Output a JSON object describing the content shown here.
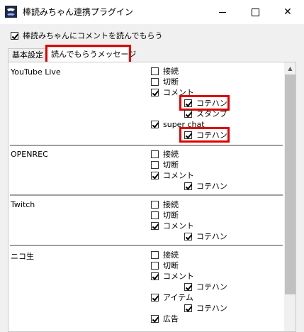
{
  "window": {
    "title": "棒読みちゃん連携プラグイン",
    "icon": "app-icon"
  },
  "main_option": {
    "label": "棒読みちゃんにコメントを読んでもらう",
    "checked": true
  },
  "tabs": [
    {
      "label": "基本設定",
      "active": false
    },
    {
      "label": "読んでもらうメッセージ",
      "active": true
    }
  ],
  "sections": {
    "youtube": {
      "title": "YouTube Live",
      "connect": {
        "label": "接続",
        "checked": false
      },
      "disconnect": {
        "label": "切断",
        "checked": false
      },
      "comment": {
        "label": "コメント",
        "checked": true
      },
      "comment_kotehan": {
        "label": "コテハン",
        "checked": true
      },
      "stamp": {
        "label": "スタンプ",
        "checked": true
      },
      "superchat": {
        "label": "super chat",
        "checked": true
      },
      "superchat_kotehan": {
        "label": "コテハン",
        "checked": true
      }
    },
    "openrec": {
      "title": "OPENREC",
      "connect": {
        "label": "接続",
        "checked": false
      },
      "disconnect": {
        "label": "切断",
        "checked": false
      },
      "comment": {
        "label": "コメント",
        "checked": true
      },
      "comment_kotehan": {
        "label": "コテハン",
        "checked": true
      }
    },
    "twitch": {
      "title": "Twitch",
      "connect": {
        "label": "接続",
        "checked": false
      },
      "disconnect": {
        "label": "切断",
        "checked": false
      },
      "comment": {
        "label": "コメント",
        "checked": true
      },
      "comment_kotehan": {
        "label": "コテハン",
        "checked": true
      }
    },
    "nico": {
      "title": "ニコ生",
      "connect": {
        "label": "接続",
        "checked": false
      },
      "disconnect": {
        "label": "切断",
        "checked": false
      },
      "comment": {
        "label": "コメント",
        "checked": true
      },
      "comment_kotehan": {
        "label": "コテハン",
        "checked": true
      },
      "item": {
        "label": "アイテム",
        "checked": true
      },
      "item_kotehan": {
        "label": "コテハン",
        "checked": true
      },
      "ad": {
        "label": "広告",
        "checked": true
      }
    }
  },
  "colors": {
    "highlight": "#e00000",
    "scroll_thumb": "#c1c1c1"
  }
}
